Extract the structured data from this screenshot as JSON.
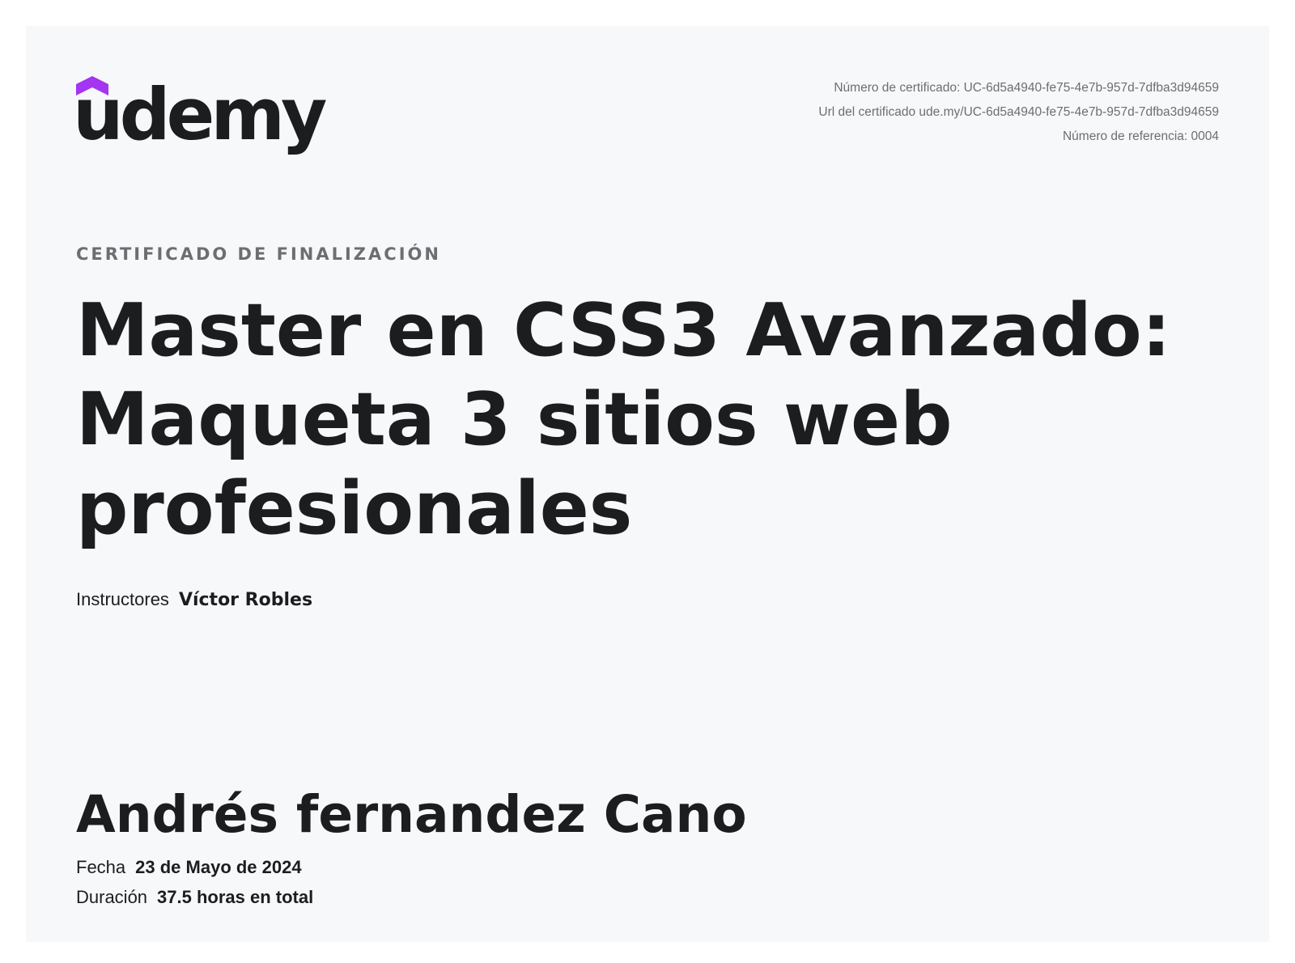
{
  "brand": {
    "name": "udemy",
    "accent_color": "#a435f0",
    "text_color": "#1c1d1f"
  },
  "certificate": {
    "number_line": "Número de certificado: UC-6d5a4940-fe75-4e7b-957d-7dfba3d94659",
    "url_line": "Url del certificado ude.my/UC-6d5a4940-fe75-4e7b-957d-7dfba3d94659",
    "reference_line": "Número de referencia: 0004"
  },
  "heading": {
    "eyebrow": "CERTIFICADO DE FINALIZACIÓN",
    "course_title": "Master en CSS3 Avanzado: Maqueta 3 sitios web profesionales"
  },
  "instructors": {
    "label": "Instructores",
    "name": "Víctor Robles"
  },
  "recipient": {
    "name": "Andrés fernandez Cano"
  },
  "details": {
    "date_label": "Fecha",
    "date_value": "23 de Mayo de 2024",
    "duration_label": "Duración",
    "duration_value": "37.5 horas en total"
  }
}
